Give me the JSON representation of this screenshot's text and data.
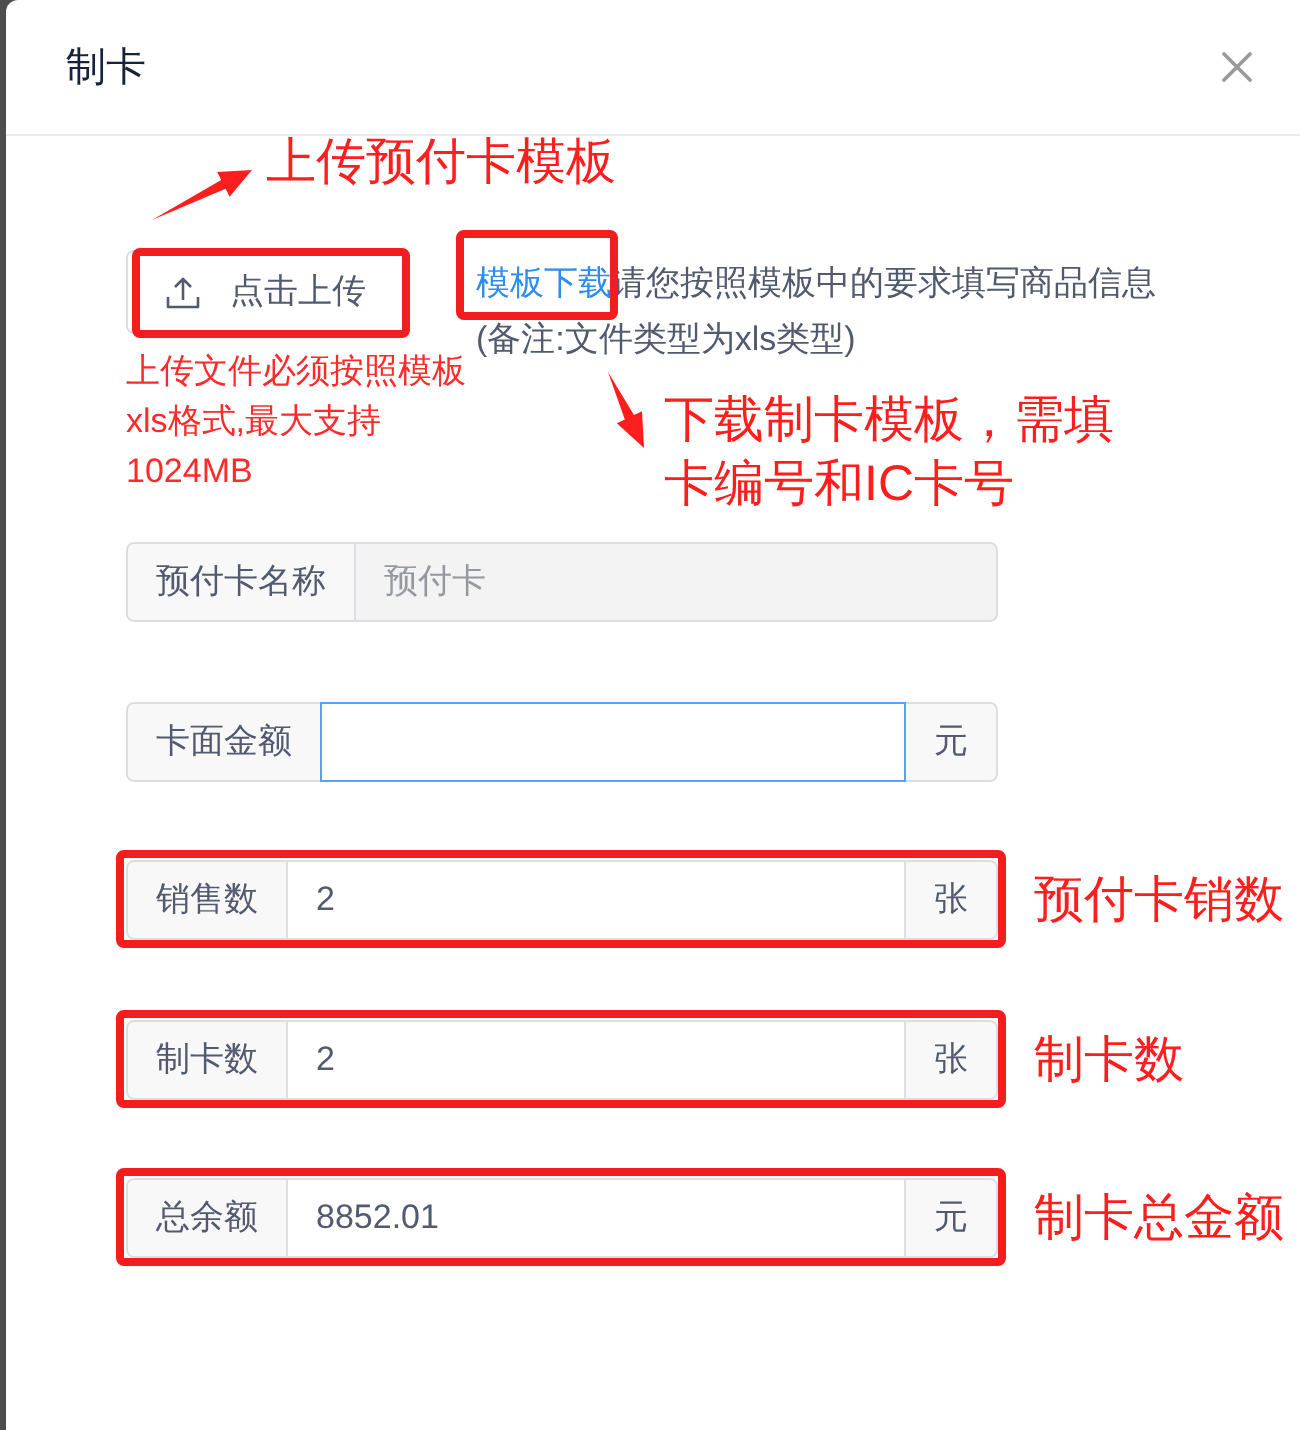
{
  "dialog": {
    "title": "制卡"
  },
  "upload": {
    "button": "点击上传",
    "highlighted": true,
    "hint_lines": [
      "上传文件必须按照模板",
      "xls格式,最大支持",
      "1024MB"
    ],
    "callout": {
      "lines": [
        "上传预付卡模板"
      ],
      "arrow": true
    }
  },
  "template": {
    "link": "模板下载",
    "highlighted": true,
    "instruction": "请您按照模板中的要求填写商品信息",
    "remark": "(备注:文件类型为xls类型)",
    "callout": {
      "lines": [
        "下载制卡模板，需填",
        "卡编号和IC卡号"
      ],
      "arrow": true
    }
  },
  "fields": [
    {
      "label": "预付卡名称",
      "placeholder": "预付卡",
      "disabled": true,
      "focused": false,
      "highlighted": false
    },
    {
      "label": "卡面金额",
      "suffix": "元",
      "disabled": false,
      "focused": true,
      "highlighted": false
    },
    {
      "label": "销售数",
      "value": "2",
      "suffix": "张",
      "disabled": false,
      "focused": false,
      "highlighted": true,
      "callout": "预付卡销数"
    },
    {
      "label": "制卡数",
      "value": "2",
      "suffix": "张",
      "disabled": false,
      "focused": false,
      "highlighted": true,
      "callout": "制卡数"
    },
    {
      "label": "总余额",
      "value": "8852.01",
      "suffix": "元",
      "disabled": false,
      "focused": false,
      "highlighted": true,
      "callout": "制卡总金额"
    }
  ]
}
